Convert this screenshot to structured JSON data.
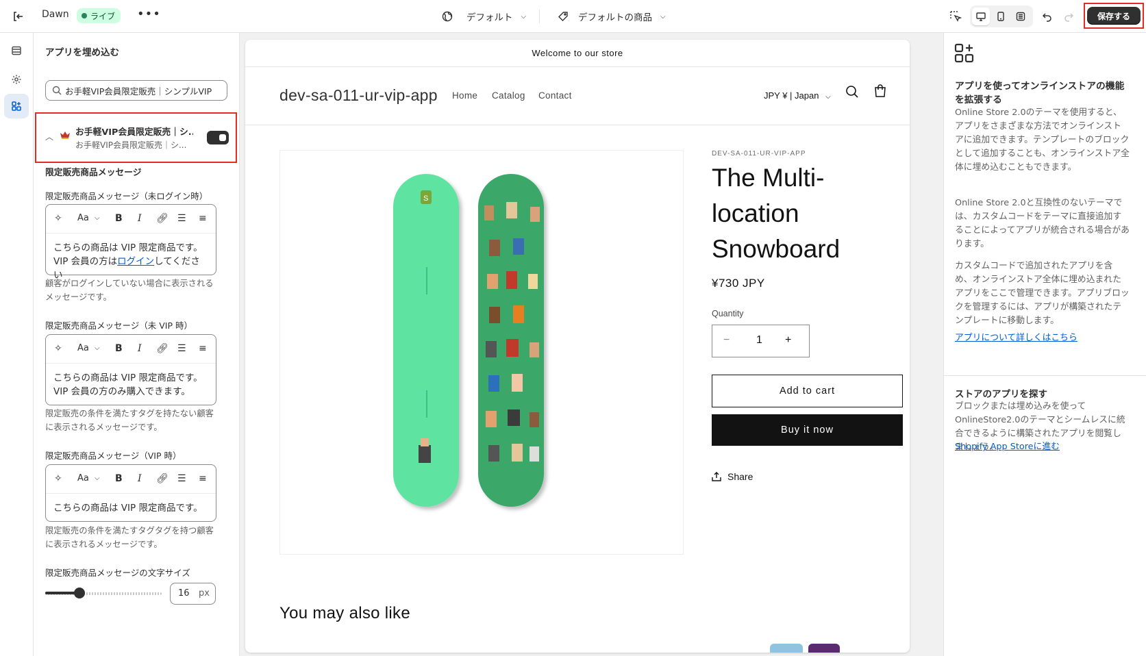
{
  "topbar": {
    "theme_name": "Dawn",
    "live_badge": "ライブ",
    "more": "•••",
    "template_select": "デフォルト",
    "product_select": "デフォルトの商品",
    "save_label": "保存する"
  },
  "left_panel": {
    "title": "アプリを埋め込む",
    "search_value": "お手軽VIP会員限定販売｜シンプルVIP",
    "app_embed": {
      "title": "お手軽VIP会員限定販売｜シ...",
      "subtitle": "お手軽VIP会員限定販売｜シ...",
      "enabled": true
    },
    "section_title": "限定販売商品メッセージ",
    "fields": [
      {
        "label": "限定販売商品メッセージ（未ログイン時）",
        "line1": "こちらの商品は VIP 限定商品です。",
        "line2_prefix": "VIP 会員の方は",
        "line2_link": "ログイン",
        "line2_suffix": "してください",
        "help": "顧客がログインしていない場合に表示されるメッセージです。"
      },
      {
        "label": "限定販売商品メッセージ（未 VIP 時）",
        "line1": "こちらの商品は VIP 限定商品です。",
        "line2": "VIP 会員の方のみ購入できます。",
        "help": "限定販売の条件を満たすタグを持たない顧客に表示されるメッセージです。"
      },
      {
        "label": "限定販売商品メッセージ（VIP 時）",
        "line1": "こちらの商品は VIP 限定商品です。",
        "help": "限定販売の条件を満たすタグタグを持つ顧客に表示されるメッセージです。"
      }
    ],
    "toolbar": {
      "font": "Aa",
      "bold": "B",
      "italic": "I"
    },
    "font_size_label": "限定販売商品メッセージの文字サイズ",
    "font_size_value": "16",
    "font_size_unit": "px"
  },
  "preview": {
    "announcement": "Welcome to our store",
    "shop_name": "dev-sa-011-ur-vip-app",
    "nav": [
      "Home",
      "Catalog",
      "Contact"
    ],
    "currency": "JPY ¥ | Japan",
    "vendor": "DEV-SA-011-UR-VIP-APP",
    "title_lines": [
      "The Multi-",
      "location",
      "Snowboard"
    ],
    "price": "¥730 JPY",
    "quantity_label": "Quantity",
    "quantity_value": "1",
    "qty_minus": "−",
    "qty_plus": "+",
    "add_to_cart": "Add to cart",
    "buy_now": "Buy it now",
    "share": "Share",
    "also_like": "You may also like"
  },
  "right_panel": {
    "heading": "アプリを使ってオンラインストアの機能を拡張する",
    "p1": "Online Store 2.0のテーマを使用すると、アプリをさまざまな方法でオンラインストアに追加できます。テンプレートのブロックとして追加することも、オンラインストア全体に埋め込むこともできます。",
    "p2": "Online Store 2.0と互換性のないテーマでは、カスタムコードをテーマに直接追加することによってアプリが統合される場合があります。",
    "p3": "カスタムコードで追加されたアプリを含め、オンラインストア全体に埋め込まれたアプリをここで管理できます。アプリブロックを管理するには、アプリが構築されたテンプレートに移動します。",
    "link1": "アプリについて詳しくはこちら",
    "heading2": "ストアのアプリを探す",
    "p4": "ブロックまたは埋め込みを使ってOnlineStore2.0のテーマとシームレスに統合できるように構築されたアプリを閲覧しましょう。",
    "link2": "Shopify App Storeに進む"
  },
  "colors": {
    "accent": "#303030",
    "live_bg": "#cdfee1",
    "highlight": "#e22d23",
    "board": "#5ee3a1",
    "board_dark": "#3aa86b"
  }
}
